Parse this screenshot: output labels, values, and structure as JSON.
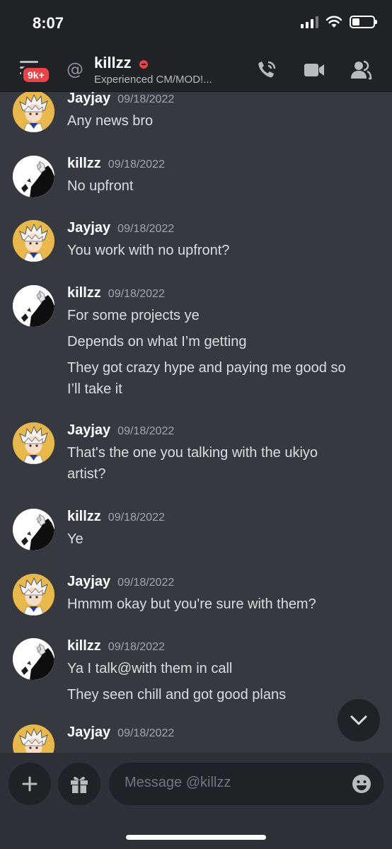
{
  "status": {
    "time": "8:07"
  },
  "header": {
    "badge": "9k+",
    "at_symbol": "@",
    "name": "killzz",
    "subtitle": "Experienced CM/MOD!..."
  },
  "messages": [
    {
      "author": "Jayjay",
      "timestamp": "09/18/2022",
      "avatar": "jayjay-avatar",
      "lines": [
        "Any news bro"
      ]
    },
    {
      "author": "killzz",
      "timestamp": "09/18/2022",
      "avatar": "killzz-avatar",
      "lines": [
        "No upfront"
      ]
    },
    {
      "author": "Jayjay",
      "timestamp": "09/18/2022",
      "avatar": "jayjay-avatar",
      "lines": [
        "You work with no upfront?"
      ]
    },
    {
      "author": "killzz",
      "timestamp": "09/18/2022",
      "avatar": "killzz-avatar",
      "lines": [
        "For some projects ye",
        "Depends on what I’m getting",
        "They got crazy hype and paying me good so",
        "I’ll take it"
      ]
    },
    {
      "author": "Jayjay",
      "timestamp": "09/18/2022",
      "avatar": "jayjay-avatar",
      "lines": [
        "That's the one you talking with the ukiyo",
        "artist?"
      ]
    },
    {
      "author": "killzz",
      "timestamp": "09/18/2022",
      "avatar": "killzz-avatar",
      "lines": [
        "Ye"
      ]
    },
    {
      "author": "Jayjay",
      "timestamp": "09/18/2022",
      "avatar": "jayjay-avatar",
      "lines": [
        "Hmmm okay but you're sure with them?"
      ]
    },
    {
      "author": "killzz",
      "timestamp": "09/18/2022",
      "avatar": "killzz-avatar",
      "lines": [
        "Ya I talk@with them in call",
        "They seen chill and got good plans"
      ]
    },
    {
      "author": "Jayjay",
      "timestamp": "09/18/2022",
      "avatar": "jayjay-avatar",
      "lines": []
    }
  ],
  "composer": {
    "placeholder": "Message @killzz"
  },
  "icons": {
    "menu": "hamburger-icon",
    "call": "phone-call-icon",
    "video": "video-camera-icon",
    "members": "members-icon",
    "scroll": "chevron-down-icon",
    "add": "plus-icon",
    "gift": "gift-icon",
    "emoji": "emoji-icon"
  },
  "colors": {
    "background": "#36393f",
    "header": "#202225",
    "badge": "#ed4245",
    "dnd": "#ed4245"
  }
}
